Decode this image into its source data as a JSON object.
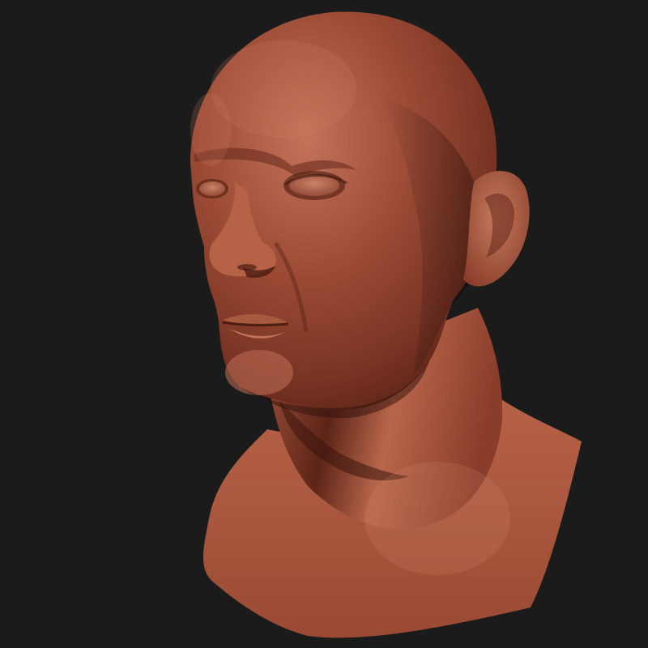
{
  "scene": {
    "subject": "sculpted-head-bust",
    "colors": {
      "background": "#1b1b1b",
      "clay_base": "#8a3f2c",
      "clay_light": "#b8644a",
      "clay_highlight": "#c97a5e",
      "clay_shadow": "#4a1c12",
      "clay_deep_shadow": "#2e0f09"
    }
  }
}
